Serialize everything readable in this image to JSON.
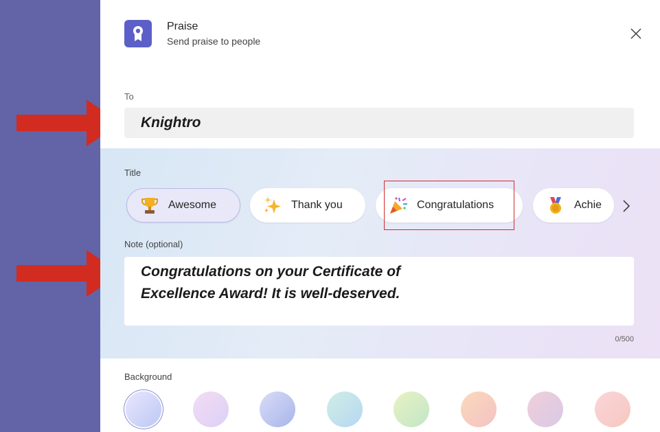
{
  "dialog": {
    "title": "Praise",
    "subtitle": "Send praise to people",
    "icon": "badge-ribbon-icon",
    "close_icon": "close-icon"
  },
  "to": {
    "label": "To",
    "value": "Knightro"
  },
  "title_section": {
    "label": "Title",
    "chips": [
      {
        "label": "Awesome",
        "icon": "trophy-icon",
        "selected": true
      },
      {
        "label": "Thank you",
        "icon": "sparkles-icon",
        "selected": false
      },
      {
        "label": "Congratulations",
        "icon": "party-popper-icon",
        "selected": false
      },
      {
        "label": "Achie",
        "icon": "medal-icon",
        "selected": false
      }
    ],
    "next_icon": "chevron-right-icon"
  },
  "note": {
    "label": "Note (optional)",
    "lines": [
      "Congratulations on your Certificate of",
      "Excellence Award! It is well-deserved."
    ],
    "counter": "0/500"
  },
  "background": {
    "label": "Background",
    "swatches": [
      {
        "name": "lavender-blue",
        "from": "#e9e6ff",
        "to": "#bcc8f2"
      },
      {
        "name": "pink-lilac",
        "from": "#f3dcf4",
        "to": "#dcd0f6"
      },
      {
        "name": "periwinkle",
        "from": "#d8dcf7",
        "to": "#a9b5ea"
      },
      {
        "name": "mint-blue",
        "from": "#cfeee6",
        "to": "#b6d7f2"
      },
      {
        "name": "lime",
        "from": "#e8f2c2",
        "to": "#c2e6c8"
      },
      {
        "name": "peach",
        "from": "#fbd9bb",
        "to": "#f4c2c4"
      },
      {
        "name": "rose-grey",
        "from": "#f0cfd8",
        "to": "#d9c9e8"
      },
      {
        "name": "blush",
        "from": "#fbd5d9",
        "to": "#f6c7c0"
      }
    ]
  },
  "colors": {
    "frame": "#6264a7",
    "accent": "#5b5fc7",
    "annotation_arrow": "#d22b1f",
    "annotation_box": "#d22b2b"
  }
}
